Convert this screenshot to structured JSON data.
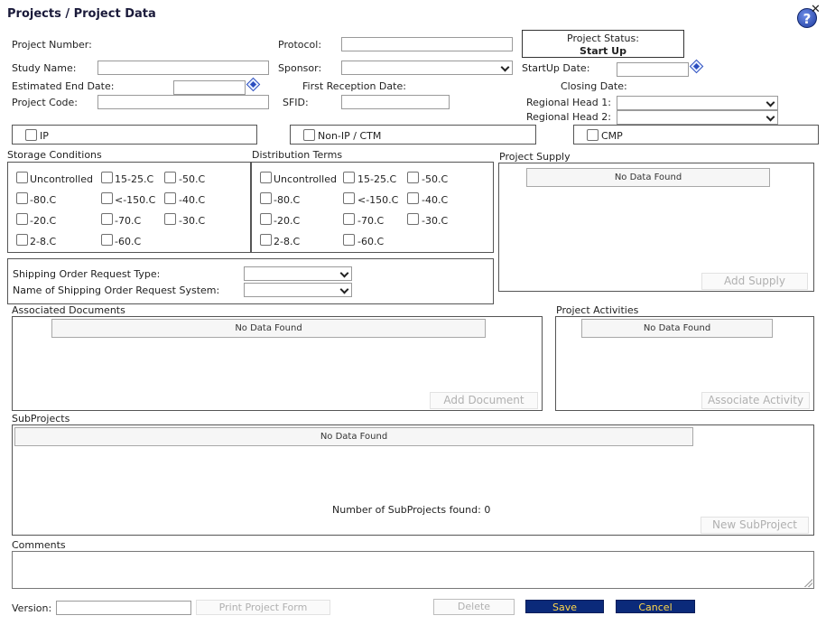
{
  "header": {
    "title": "Projects / Project Data",
    "help_glyph": "?",
    "close_glyph": "✕"
  },
  "fields": {
    "project_number": "Project Number:",
    "protocol": "Protocol:",
    "project_status_label": "Project Status:",
    "project_status_value": "Start Up",
    "study_name": "Study Name:",
    "sponsor": "Sponsor:",
    "startup_date": "StartUp Date:",
    "estimated_end_date": "Estimated End Date:",
    "first_reception_date": "First Reception Date:",
    "closing_date": "Closing Date:",
    "project_code": "Project Code:",
    "sfid": "SFID:",
    "regional_head_1": "Regional Head 1:",
    "regional_head_2": "Regional Head 2:"
  },
  "categories": {
    "ip": "IP",
    "non_ip": "Non-IP / CTM",
    "cmp": "CMP"
  },
  "storage": {
    "title": "Storage Conditions",
    "options": [
      "Uncontrolled",
      "15-25.C",
      "-50.C",
      "-80.C",
      "<-150.C",
      "-40.C",
      "-20.C",
      "-70.C",
      "-30.C",
      "2-8.C",
      "-60.C"
    ]
  },
  "distribution": {
    "title": "Distribution Terms",
    "options": [
      "Uncontrolled",
      "15-25.C",
      "-50.C",
      "-80.C",
      "<-150.C",
      "-40.C",
      "-20.C",
      "-70.C",
      "-30.C",
      "2-8.C",
      "-60.C"
    ]
  },
  "shipping": {
    "request_type": "Shipping Order Request Type:",
    "request_system": "Name of Shipping Order Request System:"
  },
  "supply": {
    "title": "Project Supply",
    "empty": "No Data Found",
    "add": "Add Supply"
  },
  "documents": {
    "title": "Associated Documents",
    "empty": "No Data Found",
    "add": "Add Document"
  },
  "activities": {
    "title": "Project Activities",
    "empty": "No Data Found",
    "add": "Associate Activity"
  },
  "subprojects": {
    "title": "SubProjects",
    "empty": "No Data Found",
    "count_text": "Number of SubProjects found: 0",
    "add": "New SubProject"
  },
  "comments": {
    "title": "Comments"
  },
  "footer": {
    "version": "Version:",
    "print": "Print Project Form",
    "delete": "Delete",
    "save": "Save",
    "cancel": "Cancel"
  },
  "colors": {
    "primary_button": "#0b2a7a",
    "primary_button_text": "#ffd84a"
  }
}
